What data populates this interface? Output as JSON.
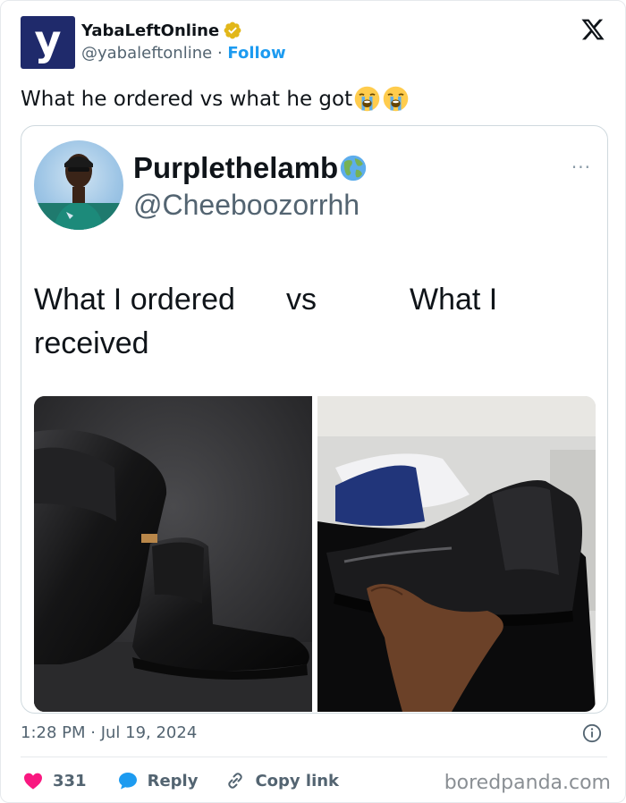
{
  "tweet": {
    "author": {
      "display_name": "YabaLeftOnline",
      "handle": "@yabaleftonline",
      "separator": "·",
      "follow_label": "Follow",
      "avatar_letter": "y",
      "verified": true
    },
    "text": "What he ordered vs what he got",
    "emojis": [
      "loudly-crying-face",
      "loudly-crying-face"
    ],
    "embedded_post": {
      "display_name": "Purplethelamb",
      "name_emoji": "globe-icon",
      "handle": "@Cheeboozorrhh",
      "caption_left": "What I ordered received",
      "caption_mid": "vs",
      "caption_right": "What I",
      "more": "···",
      "images": [
        "ordered-chelsea-boots-photo",
        "received-boot-photo"
      ]
    },
    "timestamp": "1:28 PM · Jul 19, 2024",
    "actions": {
      "like_count": "331",
      "reply_label": "Reply",
      "copy_label": "Copy link"
    }
  },
  "watermark": "boredpanda.com",
  "colors": {
    "accent": "#1d9bf0",
    "like": "#f91880",
    "avatar_bg": "#1f2a6b",
    "verified": "#e2b719",
    "muted": "#536471"
  }
}
